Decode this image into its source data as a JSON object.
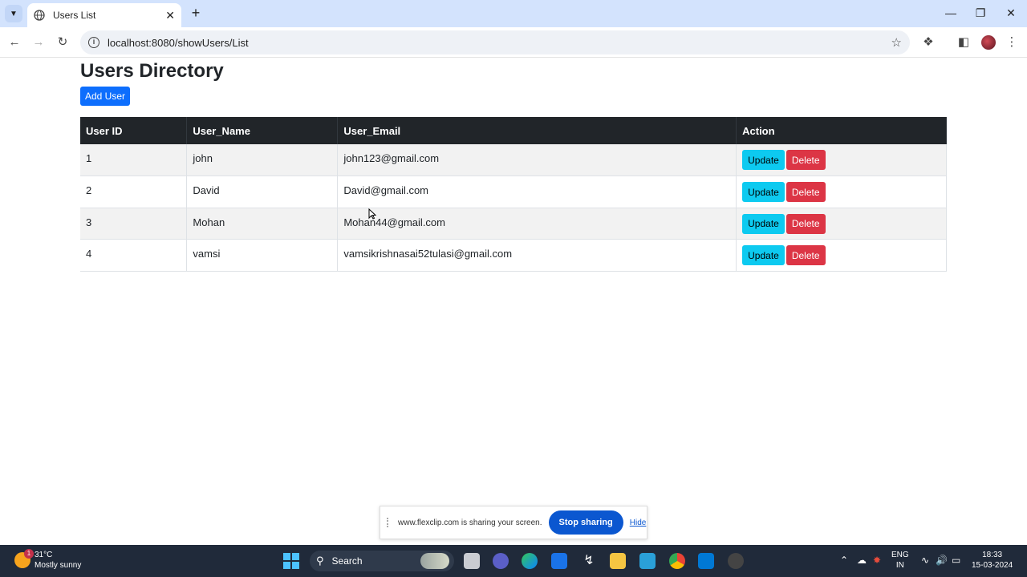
{
  "browser": {
    "tab_title": "Users List",
    "url": "localhost:8080/showUsers/List"
  },
  "page": {
    "title": "Users Directory",
    "add_button": "Add User",
    "table": {
      "headers": [
        "User ID",
        "User_Name",
        "User_Email",
        "Action"
      ],
      "rows": [
        {
          "id": "1",
          "name": "john",
          "email": "john123@gmail.com"
        },
        {
          "id": "2",
          "name": "David",
          "email": "David@gmail.com"
        },
        {
          "id": "3",
          "name": "Mohan",
          "email": "Mohan44@gmail.com"
        },
        {
          "id": "4",
          "name": "vamsi",
          "email": "vamsikrishnasai52tulasi@gmail.com"
        }
      ],
      "update_label": "Update",
      "delete_label": "Delete"
    }
  },
  "sharebar": {
    "message": "www.flexclip.com is sharing your screen.",
    "stop_label": "Stop sharing",
    "hide_label": "Hide"
  },
  "taskbar": {
    "weather_badge": "1",
    "temperature": "31°C",
    "weather": "Mostly sunny",
    "search_label": "Search",
    "lang1": "ENG",
    "lang2": "IN",
    "time": "18:33",
    "date": "15-03-2024"
  },
  "colors": {
    "primary": "#0d6efd",
    "info": "#0dcaf0",
    "danger": "#dc3545",
    "table_header": "#212529"
  }
}
